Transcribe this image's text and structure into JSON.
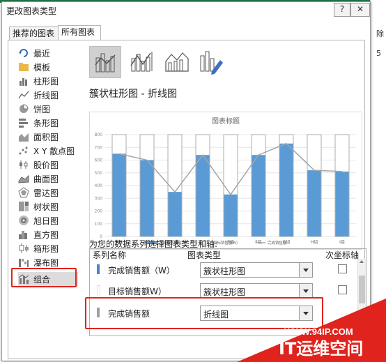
{
  "dialog": {
    "title": "更改图表类型",
    "help_label": "?",
    "close_label": "✕"
  },
  "tabs": [
    "推荐的图表",
    "所有图表"
  ],
  "chart_types": [
    {
      "label": "最近",
      "icon": "recent-icon"
    },
    {
      "label": "模板",
      "icon": "folder-icon"
    },
    {
      "label": "柱形图",
      "icon": "column-chart-icon"
    },
    {
      "label": "折线图",
      "icon": "line-chart-icon"
    },
    {
      "label": "饼图",
      "icon": "pie-chart-icon"
    },
    {
      "label": "条形图",
      "icon": "bar-chart-icon"
    },
    {
      "label": "面积图",
      "icon": "area-chart-icon"
    },
    {
      "label": "X Y 散点图",
      "icon": "scatter-chart-icon"
    },
    {
      "label": "股价图",
      "icon": "stock-chart-icon"
    },
    {
      "label": "曲面图",
      "icon": "surface-chart-icon"
    },
    {
      "label": "雷达图",
      "icon": "radar-chart-icon"
    },
    {
      "label": "树状图",
      "icon": "treemap-chart-icon"
    },
    {
      "label": "旭日图",
      "icon": "sunburst-chart-icon"
    },
    {
      "label": "直方图",
      "icon": "histogram-chart-icon"
    },
    {
      "label": "箱形图",
      "icon": "box-chart-icon"
    },
    {
      "label": "瀑布图",
      "icon": "waterfall-chart-icon"
    },
    {
      "label": "组合",
      "icon": "combo-chart-icon",
      "selected": true
    }
  ],
  "combo_heading": "簇状柱形图 - 折线图",
  "series_section_title": "为您的数据系列选择图表类型和轴:",
  "series_table": {
    "headers": {
      "name": "系列名称",
      "type": "图表类型",
      "secondary": "次坐标轴"
    },
    "rows": [
      {
        "name": "完成销售额（W）",
        "type": "簇状柱形图",
        "swatch": "#4a86c8"
      },
      {
        "name": "目标销售额W）",
        "type": "簇状柱形图",
        "swatch": "#ffffff"
      },
      {
        "name": "完成销售额",
        "type": "折线图",
        "swatch": "#a0a0a0"
      }
    ]
  },
  "chart_data": {
    "type": "bar",
    "title": "图表标题",
    "categories": [
      "A组",
      "B组",
      "C组",
      "D组",
      "E组",
      "F组",
      "G组",
      "H组",
      "I组"
    ],
    "ylim": [
      0,
      800
    ],
    "yticks": [
      "0",
      "100",
      "200",
      "300",
      "400",
      "500",
      "600",
      "700",
      "800"
    ],
    "series": [
      {
        "name": "完成销售额（W）",
        "kind": "bar",
        "color": "#5b9bd5",
        "values": [
          650,
          600,
          350,
          640,
          330,
          640,
          730,
          520,
          510
        ]
      },
      {
        "name": "目标销售额W）",
        "kind": "bar-outline",
        "color": "#ffffff",
        "values": [
          800,
          800,
          800,
          800,
          800,
          800,
          800,
          800,
          800
        ]
      },
      {
        "name": "完成销售额",
        "kind": "line",
        "color": "#a5a5a5",
        "values": [
          650,
          600,
          350,
          640,
          330,
          640,
          730,
          520,
          510
        ]
      }
    ],
    "legend": "bottom"
  },
  "background": {
    "cells": [
      "除",
      "5"
    ]
  },
  "watermark": {
    "url": "WWW.94IP.COM",
    "brand": "IT运维空间",
    "color": "#e0231c"
  },
  "colors": {
    "highlight": "#e0231c",
    "bar": "#5b9bd5"
  }
}
